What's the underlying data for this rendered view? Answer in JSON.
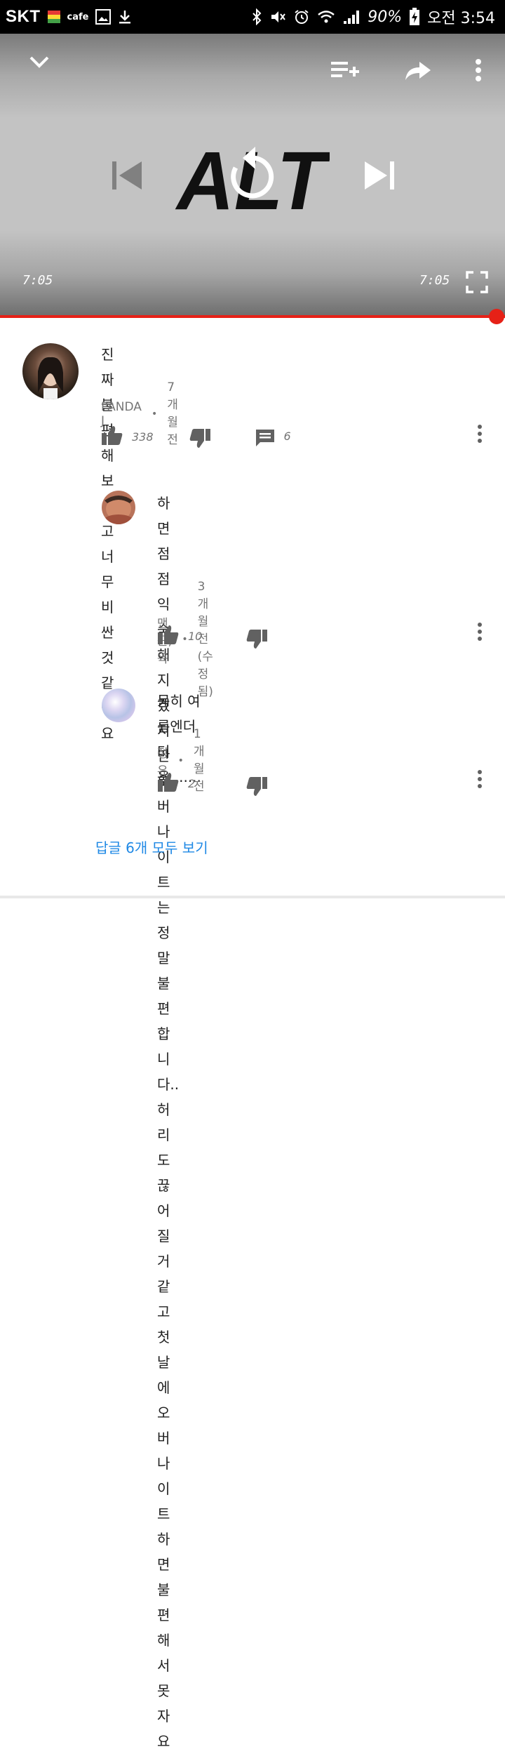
{
  "status_bar": {
    "carrier": "SKT",
    "cafe_label": "cafe",
    "battery": "90%",
    "time": "오전 3:54"
  },
  "player": {
    "logo_text": "ALT",
    "current_time": "7:05",
    "duration": "7:05",
    "progress": 1.0,
    "icons": [
      "chevron-down-icon",
      "add-to-playlist-icon",
      "share-icon",
      "more-vert-icon",
      "skip-previous-icon",
      "replay-icon",
      "skip-next-icon",
      "fullscreen-icon"
    ]
  },
  "comments": [
    {
      "text": "진짜 불편해보이고 너무 비싼것 같아요",
      "author": "PANDA J",
      "time": "7개월 전",
      "likes": "338",
      "replies": "6",
      "is_reply": false
    },
    {
      "text_lines": [
        "하면 점점 익숙해지겠지만 오버나이트는",
        "정말불편합니다.. 허리도 끊어질거같고 첫날에",
        "오버나이트하면 불편해서 못자요"
      ],
      "author": "맨 근;육",
      "time": "3개월 전(수정됨)",
      "likes": "10",
      "is_reply": true
    },
    {
      "text": "몸히 여름엔더더욱.......",
      "author": "정유",
      "time": "1개월 전",
      "likes": "2",
      "is_reply": true
    }
  ],
  "view_all_replies": "답글 6개 모두 보기",
  "colors": {
    "accent_red": "#e62117",
    "link_blue": "#1e88e5",
    "text_dark": "#212121",
    "text_grey": "#757575"
  }
}
